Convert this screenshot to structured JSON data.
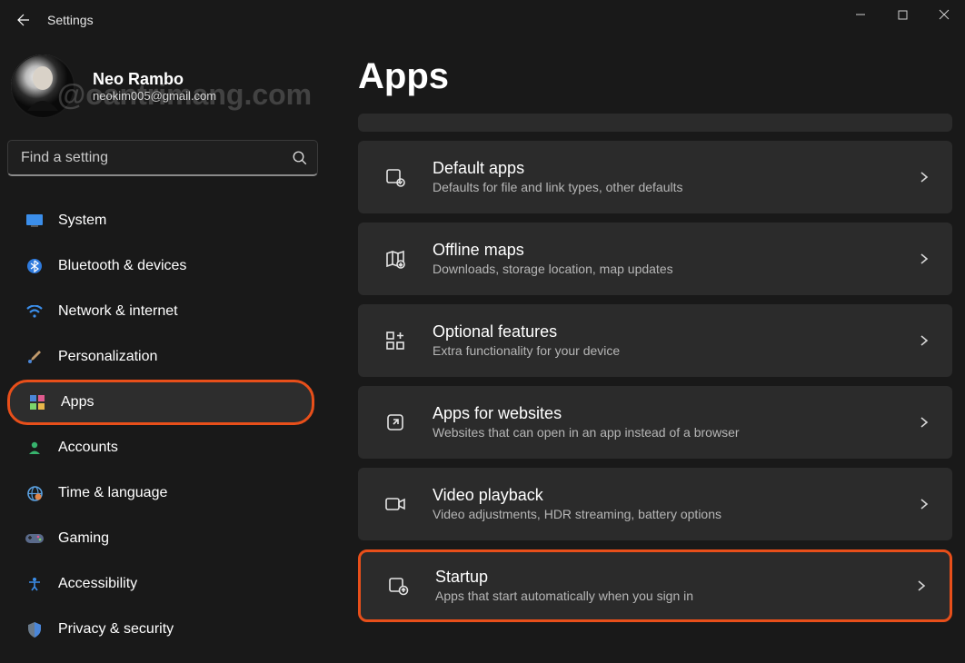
{
  "window": {
    "title": "Settings"
  },
  "profile": {
    "name": "Neo Rambo",
    "email": "neokim005@gmail.com"
  },
  "watermark": "@oantrimang.com",
  "search": {
    "placeholder": "Find a setting"
  },
  "sidebar": {
    "items": [
      {
        "icon": "🖥️",
        "label": "System"
      },
      {
        "icon": "bt",
        "label": "Bluetooth & devices"
      },
      {
        "icon": "wifi",
        "label": "Network & internet"
      },
      {
        "icon": "🖌️",
        "label": "Personalization"
      },
      {
        "icon": "apps",
        "label": "Apps",
        "active": true,
        "highlighted": true
      },
      {
        "icon": "person",
        "label": "Accounts"
      },
      {
        "icon": "🌐",
        "label": "Time & language"
      },
      {
        "icon": "🎮",
        "label": "Gaming"
      },
      {
        "icon": "acc",
        "label": "Accessibility"
      },
      {
        "icon": "shield",
        "label": "Privacy & security"
      }
    ]
  },
  "main": {
    "title": "Apps",
    "cards": [
      {
        "icon": "default",
        "title": "Default apps",
        "subtitle": "Defaults for file and link types, other defaults"
      },
      {
        "icon": "map",
        "title": "Offline maps",
        "subtitle": "Downloads, storage location, map updates"
      },
      {
        "icon": "features",
        "title": "Optional features",
        "subtitle": "Extra functionality for your device"
      },
      {
        "icon": "web",
        "title": "Apps for websites",
        "subtitle": "Websites that can open in an app instead of a browser"
      },
      {
        "icon": "video",
        "title": "Video playback",
        "subtitle": "Video adjustments, HDR streaming, battery options"
      },
      {
        "icon": "startup",
        "title": "Startup",
        "subtitle": "Apps that start automatically when you sign in",
        "highlighted": true
      }
    ]
  }
}
